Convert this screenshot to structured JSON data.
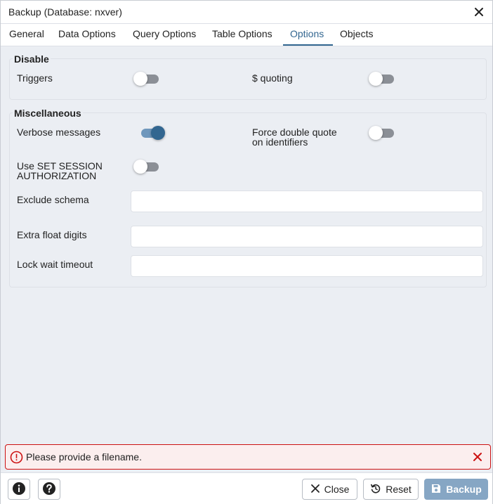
{
  "dialog": {
    "title": "Backup (Database: nxver)"
  },
  "tabs": [
    {
      "label": "General"
    },
    {
      "label": "Data Options"
    },
    {
      "label": "Query Options"
    },
    {
      "label": "Table Options"
    },
    {
      "label": "Options",
      "active": true
    },
    {
      "label": "Objects"
    }
  ],
  "disable": {
    "legend": "Disable",
    "triggers": {
      "label": "Triggers",
      "on": false
    },
    "dollar_quoting": {
      "label": "$ quoting",
      "on": false
    }
  },
  "misc": {
    "legend": "Miscellaneous",
    "verbose": {
      "label": "Verbose messages",
      "on": true
    },
    "force_double_quote": {
      "label_line1": "Force double quote",
      "label_line2": "on identifiers",
      "on": false
    },
    "set_session": {
      "label_line1": "Use SET SESSION",
      "label_line2": "AUTHORIZATION",
      "on": false
    },
    "exclude_schema": {
      "label": "Exclude schema",
      "value": ""
    },
    "extra_float_digits": {
      "label": "Extra float digits",
      "value": ""
    },
    "lock_wait_timeout": {
      "label": "Lock wait timeout",
      "value": ""
    }
  },
  "error": {
    "message": "Please provide a filename."
  },
  "footer": {
    "close_label": "Close",
    "reset_label": "Reset",
    "backup_label": "Backup"
  },
  "colors": {
    "accent": "#326690",
    "error": "#cc1111",
    "primary_button_disabled": "#86a6c4"
  },
  "icons": [
    "close-icon",
    "error-icon",
    "info-icon",
    "help-icon",
    "reset-icon",
    "save-icon"
  ]
}
